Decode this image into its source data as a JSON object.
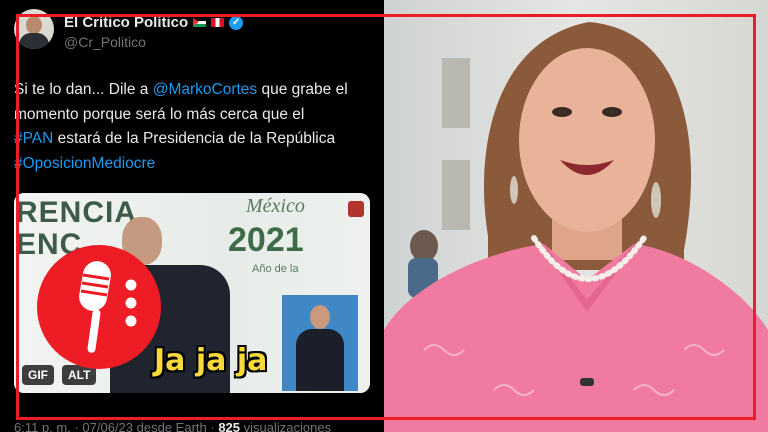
{
  "tweet": {
    "display_name": "El Crítico Político",
    "handle": "@Cr_Politico",
    "avatar_icon": "avatar-person",
    "flags": [
      "palestine-flag",
      "peru-flag"
    ],
    "verified_icon": "verified-check-icon",
    "text_lines": [
      {
        "before": "Si te lo dan... Dile a ",
        "link": "@MarkoCortes",
        "after": " que grabe el"
      },
      {
        "before": "momento porque será lo más cerca que el",
        "link": "",
        "after": ""
      },
      {
        "before": "",
        "link": "#PAN",
        "after": " estará de la Presidencia de la República"
      },
      {
        "before": "",
        "link": "#OposicionMediocre",
        "after": ""
      }
    ],
    "media": {
      "banner_text_1": "RENCIA",
      "banner_text_2": "ENC",
      "country": "México",
      "year": "2021",
      "year_caption": "Año de la",
      "caption": "Ja ja ja",
      "gif_label": "GIF",
      "alt_label": "ALT"
    },
    "meta": {
      "time": "6:11 p. m.",
      "date": "07/06/23",
      "source": "desde Earth",
      "views_count": "825",
      "views_label": "visualizaciones"
    }
  },
  "overlay": {
    "icon": "microphone-icon",
    "color": "#ee1c25"
  },
  "colors": {
    "frame": "#ee1c25",
    "link": "#1d9bf0",
    "tweet_bg": "#000000",
    "blouse": "#f07aa0"
  }
}
